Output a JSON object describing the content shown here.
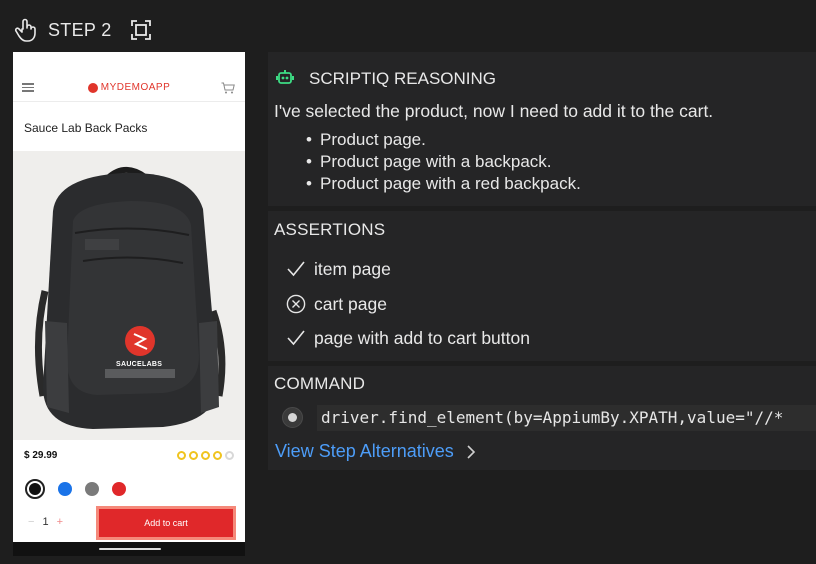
{
  "header": {
    "icon": "touch-hand-icon",
    "step_label": "STEP 2",
    "fullscreen_icon": "fullscreen-icon"
  },
  "phone": {
    "brand": "MYDEMOAPP",
    "product_title": "Sauce Lab Back Packs",
    "price": "$ 29.99",
    "rating": 4,
    "rating_max": 5,
    "colors": [
      "#111111",
      "#1a73e8",
      "#7a7a7a",
      "#e0282a"
    ],
    "selected_color_index": 0,
    "quantity": "1",
    "qty_minus": "−",
    "qty_plus": "+",
    "add_to_cart_label": "Add to cart",
    "backpack_patch_label": "SAUCELABS",
    "accent_color": "#e0282a"
  },
  "reasoning": {
    "title": "SCRIPTIQ REASONING",
    "text": "I've selected the product, now I need to add it to the cart.",
    "bullets": [
      "Product page.",
      "Product page with a backpack.",
      "Product page with a red backpack."
    ]
  },
  "assertions": {
    "title": "ASSERTIONS",
    "items": [
      {
        "label": "item page",
        "status": "pass"
      },
      {
        "label": "cart page",
        "status": "fail"
      },
      {
        "label": "page with add to cart button",
        "status": "pass"
      }
    ]
  },
  "command": {
    "title": "COMMAND",
    "code": "driver.find_element(by=AppiumBy.XPATH,value=\"//*",
    "alternatives_label": "View Step Alternatives",
    "link_color": "#4d9df8"
  }
}
